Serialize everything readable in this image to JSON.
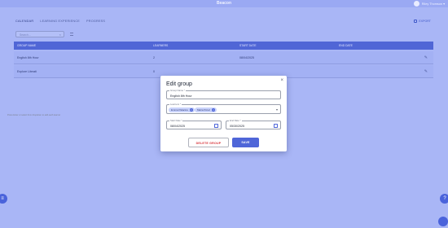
{
  "app": {
    "brand": "Beacon",
    "user_name": "Riley Thomson ▾"
  },
  "nav": {
    "tabs": [
      "CALENDAR",
      "LEARNING EXPERIENCE",
      "PROGRESS"
    ],
    "export_label": "EXPORT"
  },
  "toolbar": {
    "search_placeholder": "Search...",
    "search_clear": "×"
  },
  "table": {
    "columns": [
      "GROUP NAME",
      "LEARNERS",
      "START DATE",
      "END DATE"
    ],
    "rows": [
      {
        "name": "English 8th Hour",
        "learners": "2",
        "start": "08/04/2025"
      },
      {
        "name": "Explore Literati",
        "learners": "0",
        "start": ""
      }
    ]
  },
  "modal": {
    "title": "Edit group",
    "close": "×",
    "group_name": {
      "label": "Group Name *",
      "value": "English 8th Hour"
    },
    "learners": {
      "label": "Learners *",
      "chips": [
        "Emma Palacios",
        "Maria Pérez"
      ],
      "helper": "Press Enter or select from dropdown to add each learner"
    },
    "start_date": {
      "label": "Start Date *",
      "value": "08/04/2025"
    },
    "end_date": {
      "label": "End Date *",
      "value": "05/30/2025"
    },
    "delete_label": "DELETE GROUP",
    "save_label": "SAVE"
  },
  "icons": {
    "pencil": "✎",
    "dropdown": "▾",
    "chip_remove": "×",
    "fab_left": "≡",
    "fab_right": "?"
  },
  "colors": {
    "accent": "#4f66d8",
    "danger": "#d6343b",
    "overlay": "#a9b6f6"
  }
}
